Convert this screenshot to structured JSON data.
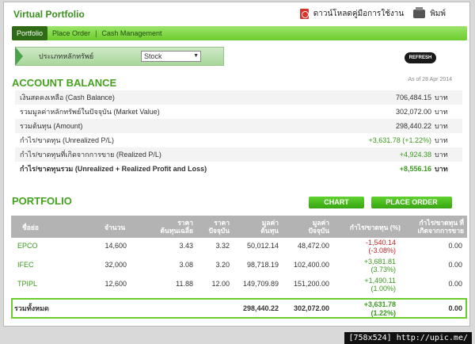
{
  "header": {
    "title": "Virtual Portfolio",
    "manual_label": "ดาวน์โหลดคู่มือการใช้งาน",
    "print_label": "พิมพ์"
  },
  "nav": {
    "tabs": [
      "Portfolio",
      "Place Order",
      "Cash Management"
    ]
  },
  "asset_type": {
    "label": "ประเภทหลักทรัพย์",
    "selected": "Stock"
  },
  "refresh_label": "REFRESH",
  "account_balance": {
    "title": "ACCOUNT BALANCE",
    "as_of": "As of 28 Apr 2014",
    "rows": [
      {
        "label": "เงินสดคงเหลือ (Cash Balance)",
        "value": "706,484.15",
        "unit": "บาท"
      },
      {
        "label": "รวมมูลค่าหลักทรัพย์ในปัจจุบัน (Market Value)",
        "value": "302,072.00",
        "unit": "บาท"
      },
      {
        "label": "รวมต้นทุน (Amount)",
        "value": "298,440.22",
        "unit": "บาท"
      },
      {
        "label": "กำไร/ขาดทุน (Unrealized P/L)",
        "value": "+3,631.78 (+1.22%)",
        "unit": "บาท"
      },
      {
        "label": "กำไร/ขาดทุนที่เกิดจากการขาย (Realized P/L)",
        "value": "+4,924.38",
        "unit": "บาท"
      },
      {
        "label": "กำไร/ขาดทุนรวม (Unrealized + Realized Profit and Loss)",
        "value": "+8,556.16",
        "unit": "บาท"
      }
    ]
  },
  "portfolio": {
    "title": "PORTFOLIO",
    "chart_btn": "CHART",
    "place_order_btn": "PLACE ORDER",
    "columns": [
      "ชื่อย่อ",
      "จำนวน",
      "ราคา\nต้นทุนเฉลี่ย",
      "ราคา\nปัจจุบัน",
      "มูลค่า\nต้นทุน",
      "มูลค่า\nปัจจุบัน",
      "กำไร/ขาดทุน (%)",
      "กำไร/ขาดทุน ที่\nเกิดจากการขาย"
    ],
    "rows": [
      {
        "symbol": "EPCO",
        "qty": "14,600",
        "avg_cost": "3.43",
        "price": "3.32",
        "cost_value": "50,012.14",
        "market_value": "48,472.00",
        "pl": "-1,540.14",
        "pl_pct": "(-3.08%)",
        "realized": "0.00"
      },
      {
        "symbol": "IFEC",
        "qty": "32,000",
        "avg_cost": "3.08",
        "price": "3.20",
        "cost_value": "98,718.19",
        "market_value": "102,400.00",
        "pl": "+3,681.81",
        "pl_pct": "(3.73%)",
        "realized": "0.00"
      },
      {
        "symbol": "TPIPL",
        "qty": "12,600",
        "avg_cost": "11.88",
        "price": "12.00",
        "cost_value": "149,709.89",
        "market_value": "151,200.00",
        "pl": "+1,490.11",
        "pl_pct": "(1.00%)",
        "realized": "0.00"
      }
    ],
    "total": {
      "label": "รวมทั้งหมด",
      "cost_value": "298,440.22",
      "market_value": "302,072.00",
      "pl": "+3,631.78",
      "pl_pct": "(1.22%)",
      "realized": "0.00"
    }
  },
  "watermark": "[758x524] http://upic.me/"
}
